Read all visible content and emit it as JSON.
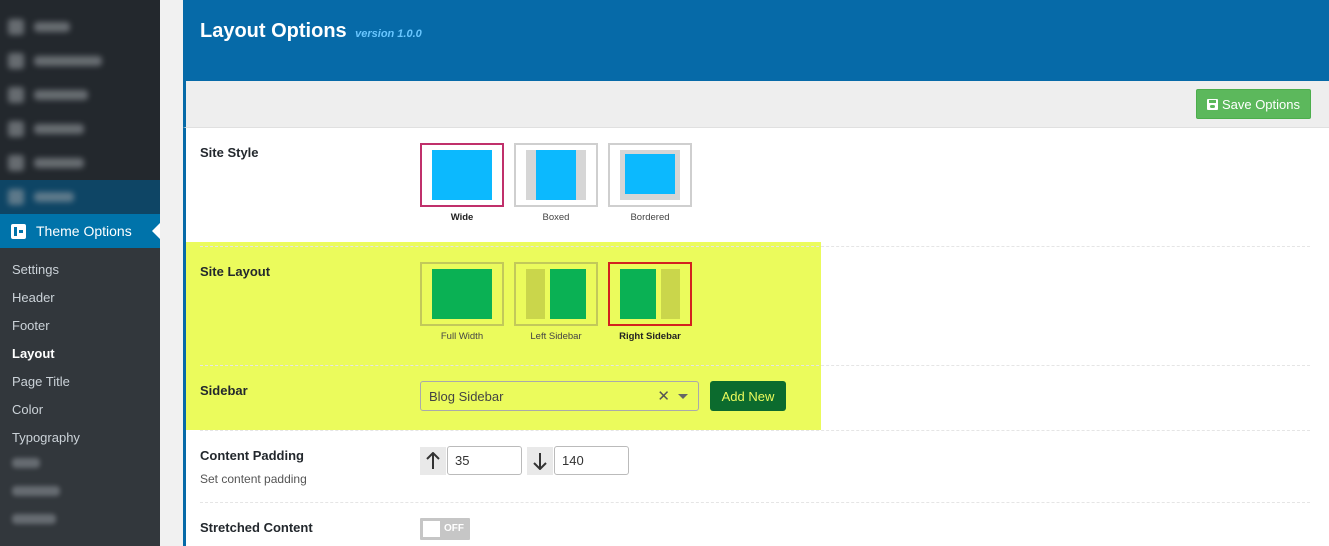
{
  "sidebar": {
    "theme_options_label": "Theme Options",
    "submenu": [
      {
        "label": "Settings",
        "active": false
      },
      {
        "label": "Header",
        "active": false
      },
      {
        "label": "Footer",
        "active": false
      },
      {
        "label": "Layout",
        "active": true
      },
      {
        "label": "Page Title",
        "active": false
      },
      {
        "label": "Color",
        "active": false
      },
      {
        "label": "Typography",
        "active": false
      }
    ]
  },
  "panel": {
    "title": "Layout Options",
    "version": "version 1.0.0",
    "save_label": "Save Options"
  },
  "site_style": {
    "label": "Site Style",
    "options": [
      "Wide",
      "Boxed",
      "Bordered"
    ],
    "selected": "Wide"
  },
  "site_layout": {
    "label": "Site Layout",
    "options": [
      "Full Width",
      "Left Sidebar",
      "Right Sidebar"
    ],
    "selected": "Right Sidebar"
  },
  "sidebar_field": {
    "label": "Sidebar",
    "value": "Blog Sidebar",
    "clear_glyph": "✕",
    "add_new_label": "Add New"
  },
  "content_padding": {
    "label": "Content Padding",
    "description": "Set content padding",
    "top_value": "35",
    "bottom_value": "140"
  },
  "stretched_content": {
    "label": "Stretched Content",
    "toggle_label": "OFF"
  },
  "colors": {
    "header_blue": "#066aa8",
    "style_preview": "#0cb9fe",
    "layout_preview": "#0ab154",
    "highlight": "#ebfb5c",
    "save_green": "#5cb85c",
    "add_new_dark_green": "#0c6b2e"
  }
}
